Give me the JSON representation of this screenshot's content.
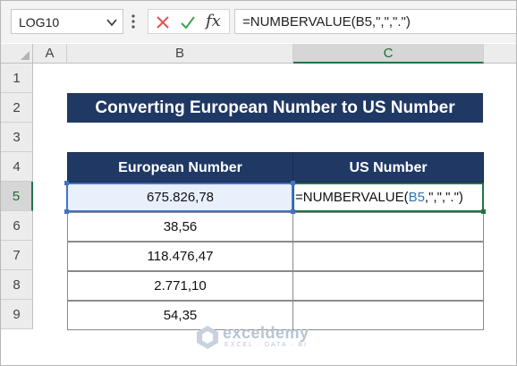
{
  "formula_bar": {
    "name_box": "LOG10",
    "formula": "=NUMBERVALUE(B5,\",\",\".\")",
    "fx_label": "fx"
  },
  "columns": [
    "A",
    "B",
    "C"
  ],
  "rows": [
    "1",
    "2",
    "3",
    "4",
    "5",
    "6",
    "7",
    "8",
    "9"
  ],
  "sheet": {
    "title": "Converting European Number to US Number",
    "headers": {
      "european": "European Number",
      "us": "US Number"
    },
    "data": [
      {
        "european": "675.826,78",
        "us": ""
      },
      {
        "european": "38,56",
        "us": ""
      },
      {
        "european": "118.476,47",
        "us": ""
      },
      {
        "european": "2.771,10",
        "us": ""
      },
      {
        "european": "54,35",
        "us": ""
      }
    ],
    "editing_cell": {
      "prefix": "=NUMBERVALUE(",
      "ref": "B5",
      "suffix": ",\",\",\".\")"
    }
  },
  "watermark": {
    "name": "exceldemy",
    "tagline": "EXCEL · DATA · BI"
  },
  "colors": {
    "header_fill": "#203864",
    "accent_green": "#217346",
    "ref_blue": "#4472c4",
    "cancel_red": "#e05555",
    "enter_green": "#3aa54a"
  }
}
